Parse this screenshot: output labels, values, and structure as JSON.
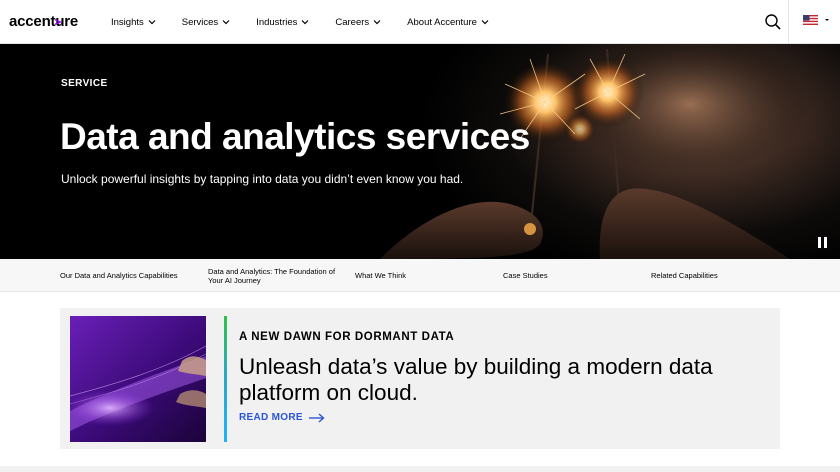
{
  "header": {
    "logo_text": "accenture",
    "brand_color": "#a100ff",
    "nav": [
      {
        "label": "Insights"
      },
      {
        "label": "Services"
      },
      {
        "label": "Industries"
      },
      {
        "label": "Careers"
      },
      {
        "label": "About Accenture"
      }
    ],
    "search_icon": "search-icon",
    "locale_icon": "us-flag-icon"
  },
  "hero": {
    "eyebrow": "SERVICE",
    "title": "Data and analytics services",
    "subtitle": "Unlock powerful insights by tapping into data you didn’t even know you had.",
    "pause_icon": "pause-icon"
  },
  "subnav": {
    "items": [
      {
        "label": "Our Data and Analytics Capabilities"
      },
      {
        "label": "Data and Analytics: The Foundation of Your AI Journey"
      },
      {
        "label": "What We Think"
      },
      {
        "label": "Case Studies"
      },
      {
        "label": "Related Capabilities"
      }
    ]
  },
  "feature": {
    "eyebrow": "A NEW DAWN FOR DORMANT DATA",
    "title": "Unleash data’s value by building a modern data platform on cloud.",
    "cta": "READ MORE",
    "cta_color": "#2a56d6"
  }
}
